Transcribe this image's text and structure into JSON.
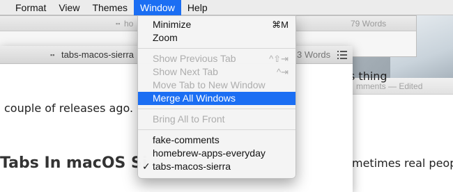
{
  "menubar": {
    "items": [
      {
        "label": "Format",
        "active": false
      },
      {
        "label": "View",
        "active": false
      },
      {
        "label": "Themes",
        "active": false
      },
      {
        "label": "Window",
        "active": true
      },
      {
        "label": "Help",
        "active": false
      }
    ]
  },
  "back_window": {
    "title": "ho",
    "word_count": "79 Words"
  },
  "main_window": {
    "title": "tabs-macos-sierra",
    "word_count": "3 Words",
    "body_line": "couple of releases ago.",
    "heading": "Tabs In macOS Si"
  },
  "right_window": {
    "title": "mments — Edited",
    "line1": "s thing",
    "line2": "metimes real peopl"
  },
  "window_menu": {
    "items": [
      {
        "label": "Minimize",
        "shortcut": "⌘M",
        "enabled": true
      },
      {
        "label": "Zoom",
        "shortcut": "",
        "enabled": true
      },
      {
        "label": "Show Previous Tab",
        "shortcut": "^⇧⇥",
        "enabled": false
      },
      {
        "label": "Show Next Tab",
        "shortcut": "^⇥",
        "enabled": false
      },
      {
        "label": "Move Tab to New Window",
        "shortcut": "",
        "enabled": false
      },
      {
        "label": "Merge All Windows",
        "shortcut": "",
        "enabled": true,
        "highlighted": true
      },
      {
        "label": "Bring All to Front",
        "shortcut": "",
        "enabled": false
      },
      {
        "label": "fake-comments",
        "shortcut": "",
        "enabled": true
      },
      {
        "label": "homebrew-apps-everyday",
        "shortcut": "",
        "enabled": true
      },
      {
        "label": "tabs-macos-sierra",
        "shortcut": "",
        "enabled": true,
        "checked": true,
        "check_mark": "✓"
      }
    ]
  },
  "colors": {
    "highlight": "#1b6ef3",
    "menubar_bg": "#ececec",
    "disabled_text": "#adadad"
  }
}
